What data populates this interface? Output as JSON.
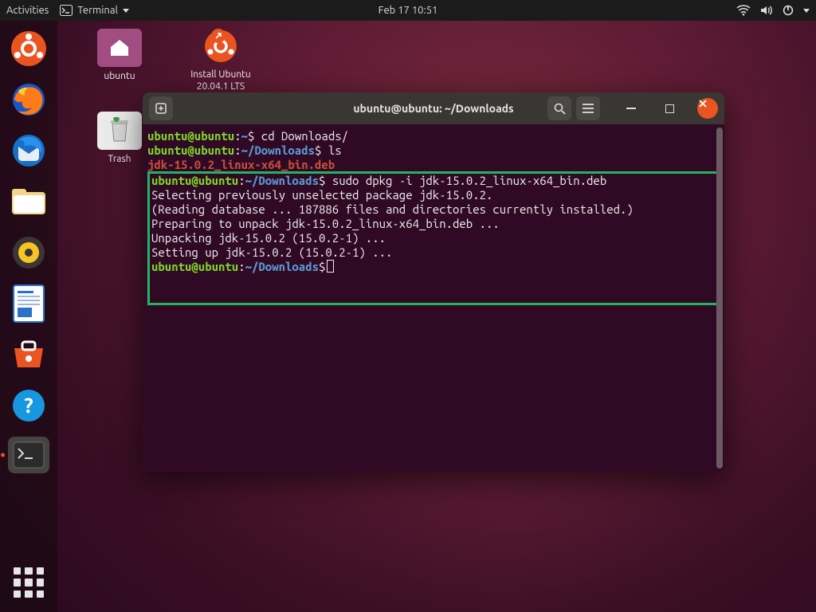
{
  "topbar": {
    "activities": "Activities",
    "app": "Terminal",
    "clock": "Feb 17  10:51"
  },
  "desktop": {
    "home": "ubuntu",
    "install_l1": "Install Ubuntu",
    "install_l2": "20.04.1 LTS",
    "trash": "Trash"
  },
  "dock": {
    "items": [
      "ubuntu-logo",
      "firefox",
      "thunderbird",
      "files",
      "rhythmbox",
      "libreoffice-writer",
      "software",
      "help",
      "terminal"
    ]
  },
  "terminal": {
    "title": "ubuntu@ubuntu: ~/Downloads",
    "prompt_user": "ubuntu@ubuntu",
    "path_home": "~",
    "path_dl": "~/Downloads",
    "cmd1": " cd Downloads/",
    "cmd2": " ls",
    "ls_out": "jdk-15.0.2_linux-x64_bin.deb",
    "cmd3": " sudo dpkg -i jdk-15.0.2_linux-x64_bin.deb",
    "out1": "Selecting previously unselected package jdk-15.0.2.",
    "out2": "(Reading database ... 187886 files and directories currently installed.)",
    "out3": "Preparing to unpack jdk-15.0.2_linux-x64_bin.deb ...",
    "out4": "Unpacking jdk-15.0.2 (15.0.2-1) ...",
    "out5": "Setting up jdk-15.0.2 (15.0.2-1) ..."
  }
}
